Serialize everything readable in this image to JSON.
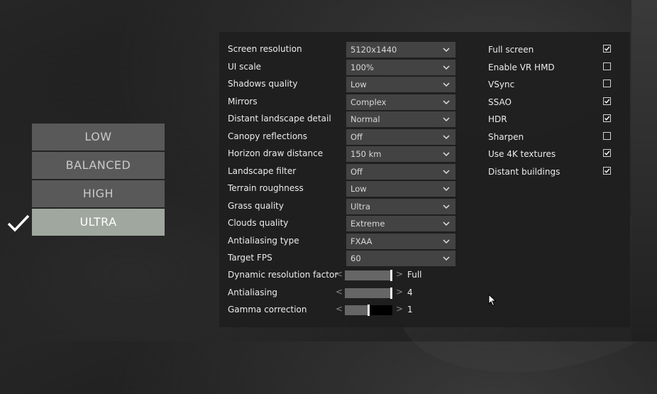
{
  "presets": [
    {
      "label": "LOW",
      "active": false
    },
    {
      "label": "BALANCED",
      "active": false
    },
    {
      "label": "HIGH",
      "active": false
    },
    {
      "label": "ULTRA",
      "active": true
    }
  ],
  "dropdowns": [
    {
      "label": "Screen resolution",
      "value": "5120x1440"
    },
    {
      "label": "UI scale",
      "value": "100%"
    },
    {
      "label": "Shadows quality",
      "value": "Low"
    },
    {
      "label": "Mirrors",
      "value": "Complex"
    },
    {
      "label": "Distant landscape detail",
      "value": "Normal"
    },
    {
      "label": "Canopy reflections",
      "value": "Off"
    },
    {
      "label": "Horizon draw distance",
      "value": "150 km"
    },
    {
      "label": "Landscape filter",
      "value": "Off"
    },
    {
      "label": "Terrain roughness",
      "value": "Low"
    },
    {
      "label": "Grass quality",
      "value": "Ultra"
    },
    {
      "label": "Clouds quality",
      "value": "Extreme"
    },
    {
      "label": "Antialiasing type",
      "value": "FXAA"
    },
    {
      "label": "Target FPS",
      "value": "60"
    }
  ],
  "sliders": [
    {
      "label": "Dynamic resolution factor",
      "value": "Full",
      "level": 1.0
    },
    {
      "label": "Antialiasing",
      "value": "4",
      "level": 1.0
    },
    {
      "label": "Gamma correction",
      "value": "1",
      "level": 0.5
    }
  ],
  "checkboxes": [
    {
      "label": "Full screen",
      "checked": true
    },
    {
      "label": "Enable VR HMD",
      "checked": false
    },
    {
      "label": "VSync",
      "checked": false
    },
    {
      "label": "SSAO",
      "checked": true
    },
    {
      "label": "HDR",
      "checked": true
    },
    {
      "label": "Sharpen",
      "checked": false
    },
    {
      "label": "Use 4K textures",
      "checked": true
    },
    {
      "label": "Distant buildings",
      "checked": true
    }
  ],
  "arrows": {
    "left": "<",
    "right": ">"
  },
  "colors": {
    "preset_active": "#a0a79f",
    "preset_inactive": "#595959",
    "panel": "#1e1e1e"
  }
}
